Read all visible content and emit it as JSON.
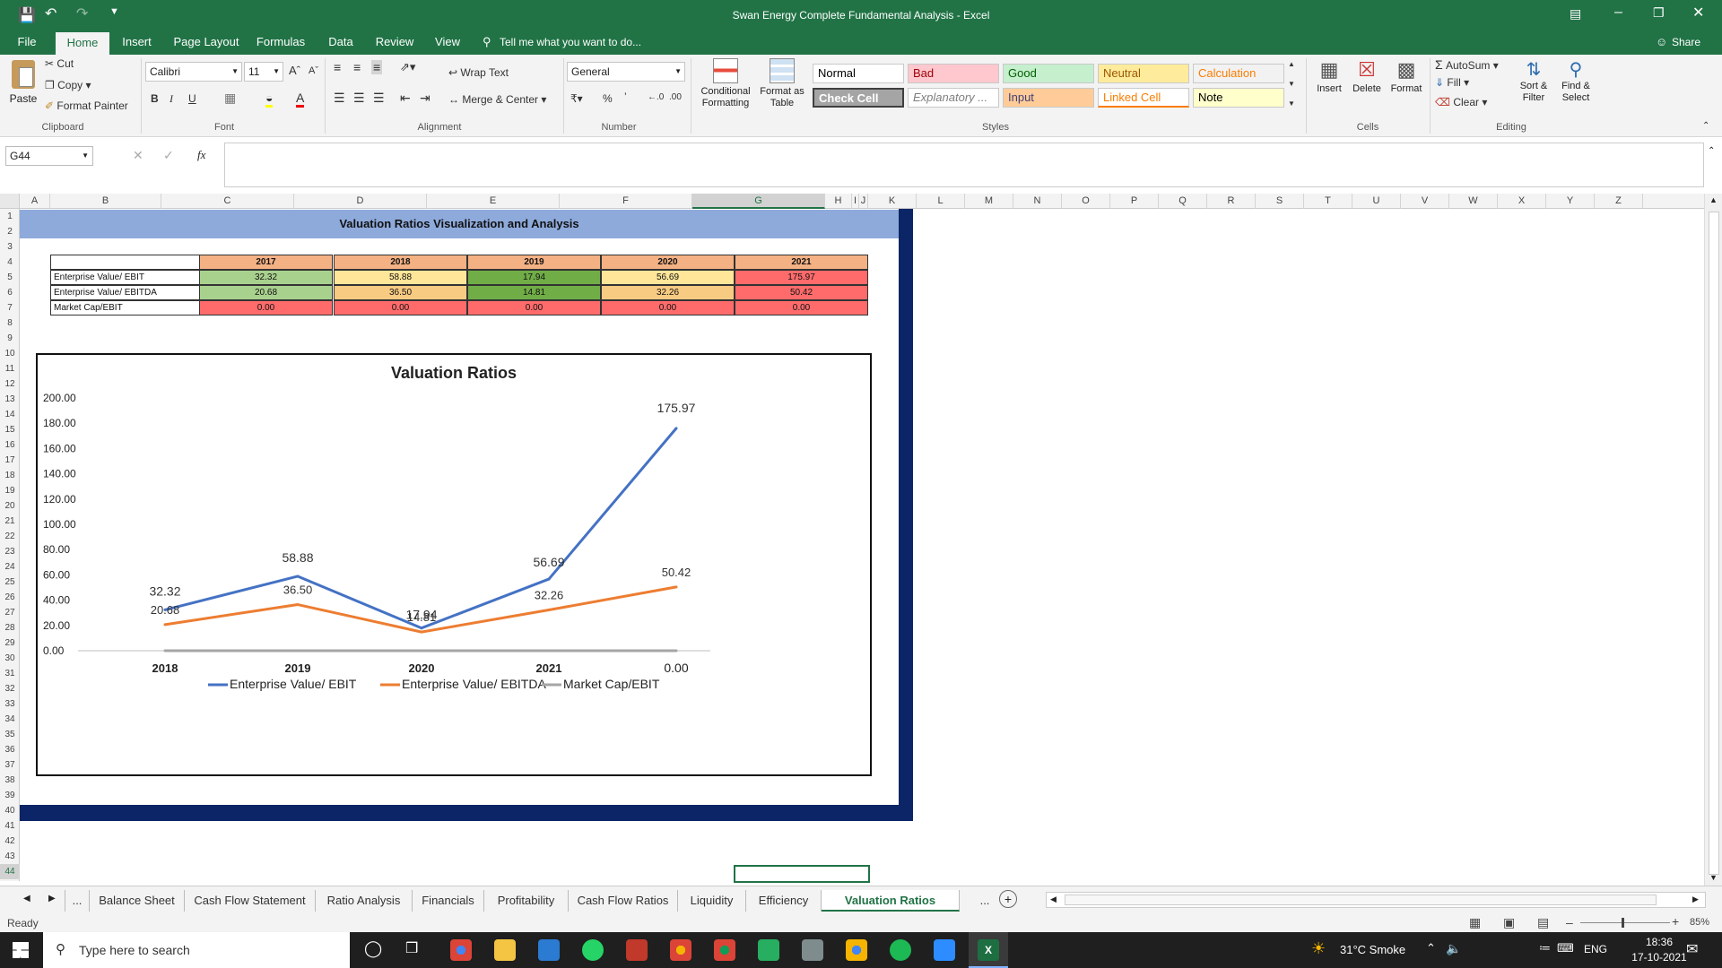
{
  "window": {
    "title": "Swan Energy Complete Fundamental Analysis  -  Excel"
  },
  "ribbon_tabs": [
    "File",
    "Home",
    "Insert",
    "Page Layout",
    "Formulas",
    "Data",
    "Review",
    "View"
  ],
  "tell_me": "Tell me what you want to do...",
  "share": "Share",
  "clipboard": {
    "paste": "Paste",
    "cut": "Cut",
    "copy": "Copy",
    "format_painter": "Format Painter",
    "group": "Clipboard"
  },
  "font": {
    "name": "Calibri",
    "size": "11",
    "group": "Font"
  },
  "alignment": {
    "wrap": "Wrap Text",
    "merge": "Merge & Center",
    "group": "Alignment"
  },
  "number": {
    "format": "General",
    "group": "Number"
  },
  "styles": {
    "conditional": "Conditional Formatting",
    "format_table": "Format as Table",
    "group": "Styles",
    "items": [
      {
        "label": "Normal",
        "bg": "#ffffff",
        "fg": "#000000"
      },
      {
        "label": "Bad",
        "bg": "#ffc7ce",
        "fg": "#9c0006"
      },
      {
        "label": "Good",
        "bg": "#c6efce",
        "fg": "#006100"
      },
      {
        "label": "Neutral",
        "bg": "#ffeb9c",
        "fg": "#9c5700"
      },
      {
        "label": "Calculation",
        "bg": "#f2f2f2",
        "fg": "#fa7d00"
      },
      {
        "label": "Check Cell",
        "bg": "#a5a5a5",
        "fg": "#ffffff"
      },
      {
        "label": "Explanatory ...",
        "bg": "#ffffff",
        "fg": "#7f7f7f"
      },
      {
        "label": "Input",
        "bg": "#ffcc99",
        "fg": "#3f3f76"
      },
      {
        "label": "Linked Cell",
        "bg": "#ffffff",
        "fg": "#fa7d00"
      },
      {
        "label": "Note",
        "bg": "#ffffcc",
        "fg": "#000000"
      }
    ]
  },
  "cells_group": {
    "insert": "Insert",
    "delete": "Delete",
    "format": "Format",
    "group": "Cells"
  },
  "editing": {
    "autosum": "AutoSum",
    "fill": "Fill",
    "clear": "Clear",
    "sort": "Sort & Filter",
    "find": "Find & Select",
    "group": "Editing"
  },
  "formula_bar": {
    "name_box": "G44",
    "fx": "fx",
    "value": ""
  },
  "columns": [
    "A",
    "B",
    "C",
    "D",
    "E",
    "F",
    "G",
    "H",
    "I",
    "J",
    "K",
    "L",
    "M",
    "N",
    "O",
    "P",
    "Q",
    "R",
    "S",
    "T",
    "U",
    "V",
    "W",
    "X",
    "Y",
    "Z"
  ],
  "rows": [
    "1",
    "2",
    "3",
    "4",
    "5",
    "6",
    "7",
    "8",
    "9",
    "10",
    "11",
    "12",
    "13",
    "14",
    "15",
    "16",
    "17",
    "18",
    "19",
    "20",
    "21",
    "22",
    "23",
    "24",
    "25",
    "26",
    "27",
    "28",
    "29",
    "30",
    "31",
    "32",
    "33",
    "34",
    "35",
    "36",
    "37",
    "38",
    "39",
    "40",
    "41",
    "42",
    "43",
    "44"
  ],
  "sheet": {
    "banner": "Valuation Ratios Visualization and Analysis",
    "years": [
      "2017",
      "2018",
      "2019",
      "2020",
      "2021"
    ],
    "table": [
      {
        "label": "Enterprise Value/ EBIT",
        "values": [
          "32.32",
          "58.88",
          "17.94",
          "56.69",
          "175.97"
        ],
        "colors": [
          "#a9d18e",
          "#ffe699",
          "#70ad47",
          "#ffe699",
          "#ff6b6b"
        ]
      },
      {
        "label": "Enterprise Value/ EBITDA",
        "values": [
          "20.68",
          "36.50",
          "14.81",
          "32.26",
          "50.42"
        ],
        "colors": [
          "#a9d18e",
          "#f8cb82",
          "#70ad47",
          "#f8cb82",
          "#ff6b6b"
        ]
      },
      {
        "label": "Market Cap/EBIT",
        "values": [
          "0.00",
          "0.00",
          "0.00",
          "0.00",
          "0.00"
        ],
        "colors": [
          "#ff6b6b",
          "#ff6b6b",
          "#ff6b6b",
          "#ff6b6b",
          "#ff6b6b"
        ]
      }
    ]
  },
  "chart_data": {
    "type": "line",
    "title": "Valuation Ratios",
    "categories": [
      "2018",
      "2019",
      "2020",
      "2021",
      "0.00"
    ],
    "ylim": [
      0,
      200
    ],
    "yticks": [
      "0.00",
      "20.00",
      "40.00",
      "60.00",
      "80.00",
      "100.00",
      "120.00",
      "140.00",
      "160.00",
      "180.00",
      "200.00"
    ],
    "grid": false,
    "legend": "bottom",
    "series": [
      {
        "name": "Enterprise Value/ EBIT",
        "color": "#4472c4",
        "values": [
          32.32,
          58.88,
          17.94,
          56.69,
          175.97
        ],
        "labels": [
          "32.32",
          "58.88",
          "17.94",
          "56.69",
          "175.97"
        ]
      },
      {
        "name": "Enterprise Value/ EBITDA",
        "color": "#ed7d31",
        "values": [
          20.68,
          36.5,
          14.81,
          32.26,
          50.42
        ],
        "labels": [
          "20.68",
          "36.50",
          "14.81",
          "32.26",
          "50.42"
        ]
      },
      {
        "name": "Market Cap/EBIT",
        "color": "#a5a5a5",
        "values": [
          0,
          0,
          0,
          0,
          0
        ],
        "labels": []
      }
    ]
  },
  "sheet_tabs": [
    "...",
    "Balance Sheet",
    "Cash Flow Statement",
    "Ratio Analysis",
    "Financials",
    "Profitability",
    "Cash Flow Ratios",
    "Liquidity",
    "Efficiency",
    "Valuation Ratios",
    "..."
  ],
  "status": {
    "ready": "Ready",
    "zoom": "85%"
  },
  "taskbar": {
    "search": "Type here to search",
    "weather": "31°C  Smoke",
    "lang": "ENG",
    "time": "18:36",
    "date": "17-10-2021"
  }
}
